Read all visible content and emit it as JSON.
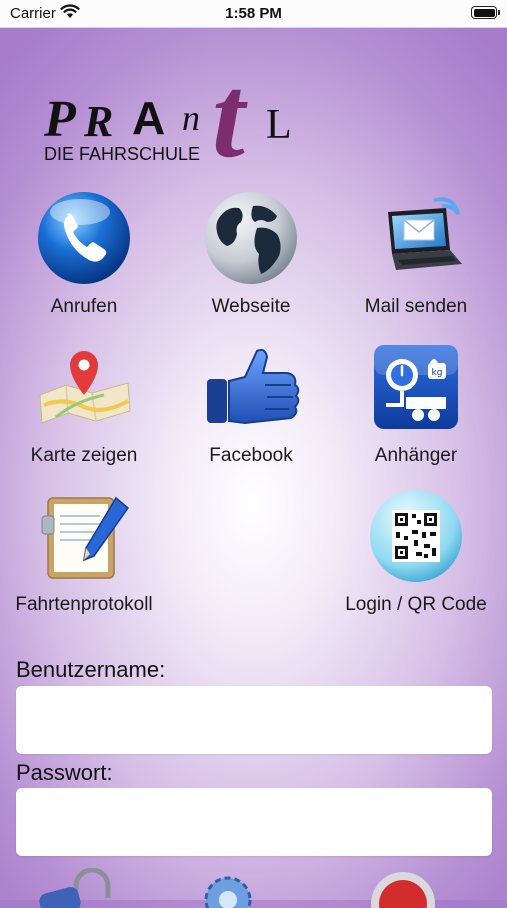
{
  "status": {
    "carrier": "Carrier",
    "time": "1:58 PM"
  },
  "logo": {
    "letters": [
      "P",
      "R",
      "A",
      "n",
      "t",
      "L"
    ],
    "subtitle": "DIE FAHRSCHULE"
  },
  "grid": [
    {
      "label": "Anrufen",
      "icon": "phone-icon"
    },
    {
      "label": "Webseite",
      "icon": "globe-icon"
    },
    {
      "label": "Mail senden",
      "icon": "mail-laptop-icon"
    },
    {
      "label": "Karte zeigen",
      "icon": "map-pin-icon"
    },
    {
      "label": "Facebook",
      "icon": "thumbs-up-icon"
    },
    {
      "label": "Anhänger",
      "icon": "trailer-icon"
    },
    {
      "label": "Fahrtenprotokoll",
      "icon": "clipboard-pen-icon"
    },
    {
      "label": "Login / QR Code",
      "icon": "qr-code-icon"
    }
  ],
  "login": {
    "username_label": "Benutzername:",
    "username_value": "",
    "password_label": "Passwort:",
    "password_value": ""
  },
  "bottom_icons": [
    "lock-icon",
    "settings-gear-icon",
    "power-button-icon"
  ],
  "colors": {
    "accent_purple": "#7b2d6f",
    "background_purple": "#b58fd3"
  }
}
